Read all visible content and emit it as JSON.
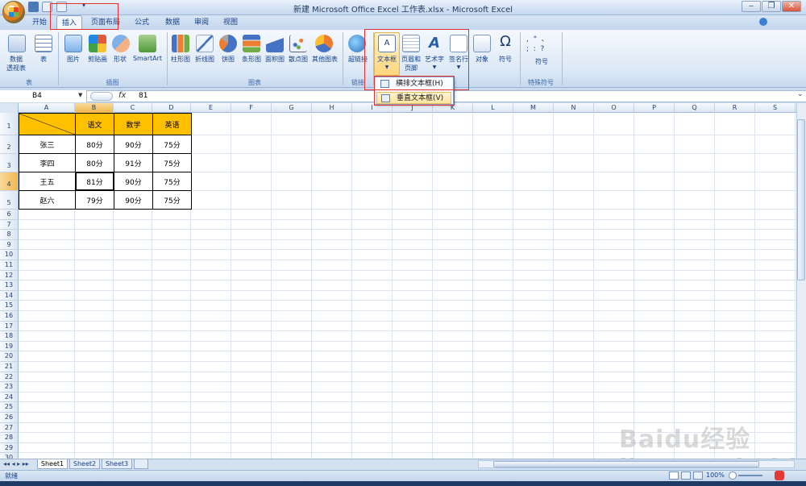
{
  "window": {
    "title": "新建 Microsoft Office Excel 工作表.xlsx - Microsoft Excel",
    "minimize": "‒",
    "maximize": "❐",
    "close": "✕"
  },
  "tabs": [
    "开始",
    "插入",
    "页面布局",
    "公式",
    "数据",
    "审阅",
    "视图"
  ],
  "active_tab": "插入",
  "ribbon": {
    "groups": {
      "tables": "表",
      "illustrations": "插图",
      "charts": "图表",
      "links": "链接",
      "text": "文本",
      "special": "特殊符号"
    },
    "buttons": {
      "pivot": "数据\n透视表",
      "pivot_l1": "数据",
      "pivot_l2": "透视表",
      "table": "表",
      "picture": "图片",
      "clipart": "剪贴画",
      "shapes": "形状",
      "smartart": "SmartArt",
      "column": "柱形图",
      "line": "折线图",
      "pie": "饼图",
      "bar": "条形图",
      "area": "面积图",
      "scatter": "散点图",
      "other": "其他图表",
      "hyperlink": "超链接",
      "textbox": "文本框",
      "header_l1": "页眉和",
      "header_l2": "页脚",
      "wordart": "艺术字",
      "signature": "签名行",
      "object": "对象",
      "symbol": "符号",
      "special_symbol": "符号"
    }
  },
  "dropdown": {
    "items": [
      "横排文本框(H)",
      "垂直文本框(V)"
    ]
  },
  "formula_bar": {
    "name_box": "B4",
    "fx": "fx",
    "value": "81"
  },
  "columns": [
    "A",
    "B",
    "C",
    "D",
    "E",
    "F",
    "G",
    "H",
    "I",
    "J",
    "K",
    "L",
    "M",
    "N",
    "O",
    "P",
    "Q",
    "R",
    "S"
  ],
  "rows": [
    "1",
    "2",
    "3",
    "4",
    "5",
    "6",
    "7",
    "8",
    "9",
    "10",
    "11",
    "12",
    "13",
    "14",
    "15",
    "16",
    "17",
    "18",
    "19",
    "20",
    "21",
    "22",
    "23",
    "24",
    "25",
    "26",
    "27",
    "28",
    "29",
    "30"
  ],
  "table": {
    "headers": [
      "语文",
      "数学",
      "英语"
    ],
    "rows": [
      {
        "name": "张三",
        "values": [
          "80分",
          "90分",
          "75分"
        ]
      },
      {
        "name": "李四",
        "values": [
          "80分",
          "91分",
          "75分"
        ]
      },
      {
        "name": "王五",
        "values": [
          "81分",
          "90分",
          "75分"
        ]
      },
      {
        "name": "赵六",
        "values": [
          "79分",
          "90分",
          "75分"
        ]
      }
    ]
  },
  "sheets": [
    "Sheet1",
    "Sheet2",
    "Sheet3"
  ],
  "status": {
    "ready": "就绪",
    "zoom": "100%"
  },
  "watermark": "Baidu经验 jingyan.baidu.com",
  "colors": {
    "header_fill": "#ffc000",
    "highlight_red": "#e03030"
  }
}
